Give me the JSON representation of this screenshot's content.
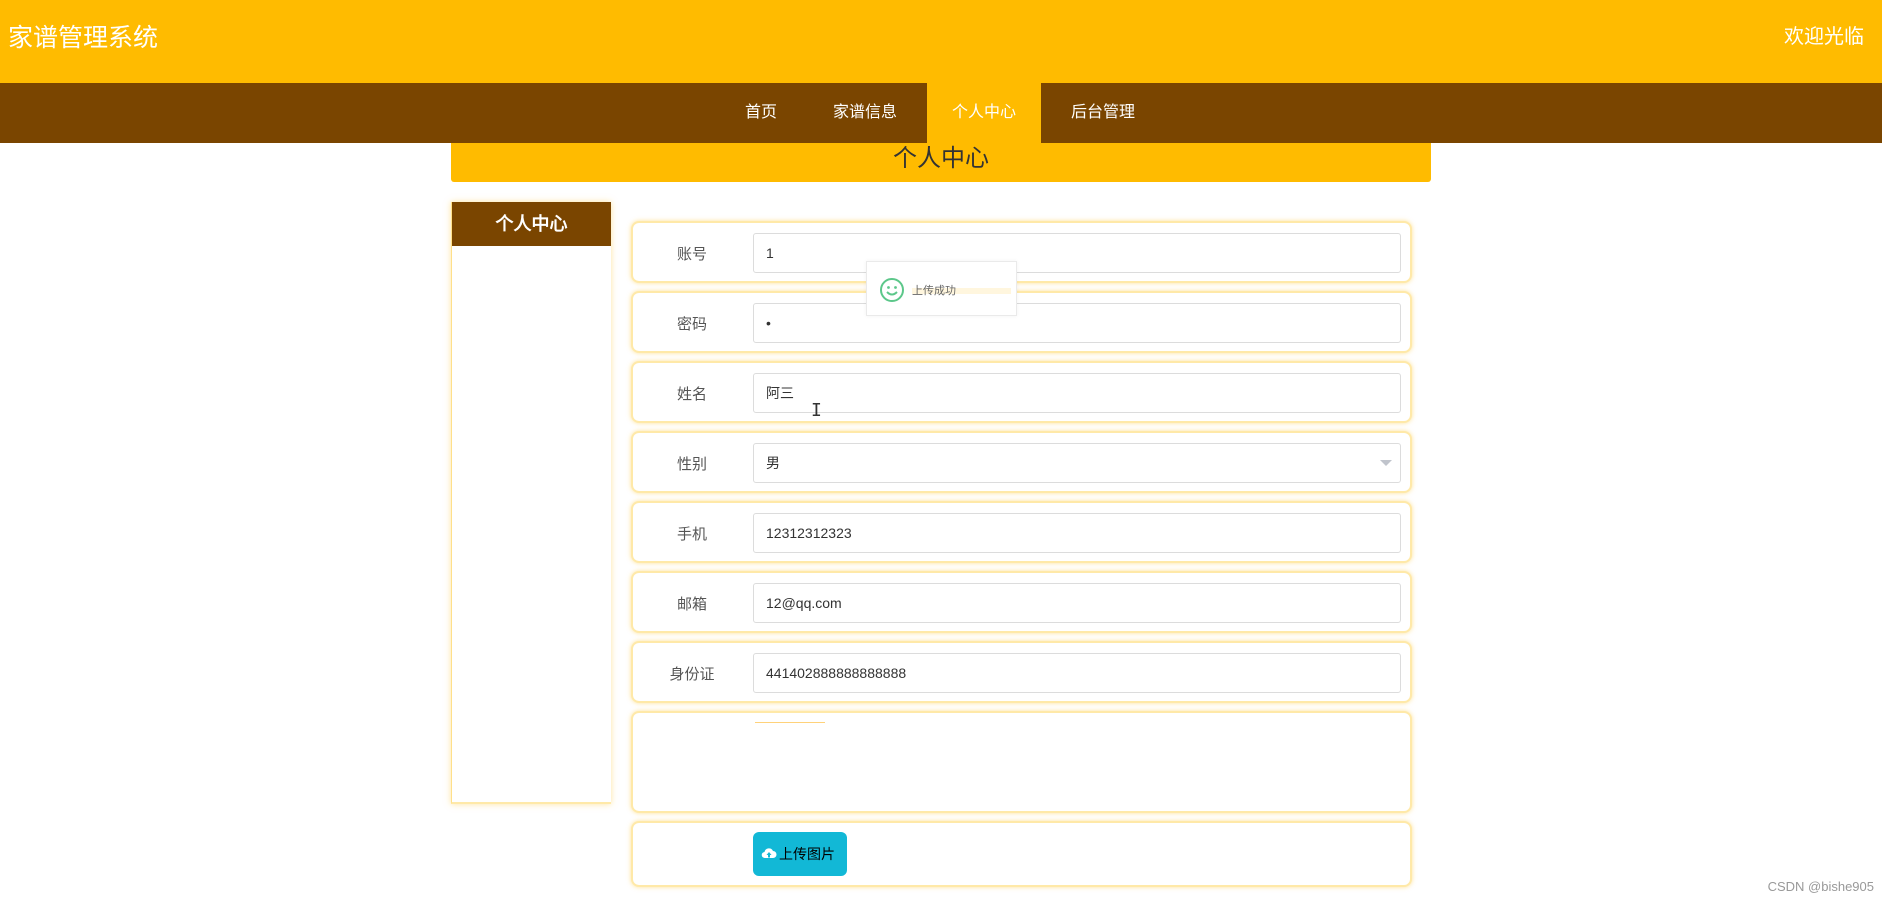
{
  "header": {
    "brand": "家谱管理系统",
    "welcome": "欢迎光临"
  },
  "nav": {
    "items": [
      "首页",
      "家谱信息",
      "个人中心",
      "后台管理"
    ],
    "active": "个人中心"
  },
  "page": {
    "title": "个人中心"
  },
  "sidebar": {
    "title": "个人中心"
  },
  "form": {
    "account": {
      "label": "账号",
      "value": "1"
    },
    "password": {
      "label": "密码",
      "value": "•"
    },
    "name": {
      "label": "姓名",
      "value": "阿三"
    },
    "gender": {
      "label": "性别",
      "value": "男"
    },
    "phone": {
      "label": "手机",
      "value": "12312312323"
    },
    "email": {
      "label": "邮箱",
      "value": "12@qq.com"
    },
    "idcard": {
      "label": "身份证",
      "value": "441402888888888888"
    },
    "upload_label": "上传图片"
  },
  "toast": {
    "text": "上传成功",
    "icon": "smile-icon"
  },
  "watermark": "CSDN @bishe905",
  "colors": {
    "header": "#ffbb00",
    "nav": "#7a4500",
    "upload_button": "#12b8d6",
    "toast_icon": "#5cc78a"
  }
}
